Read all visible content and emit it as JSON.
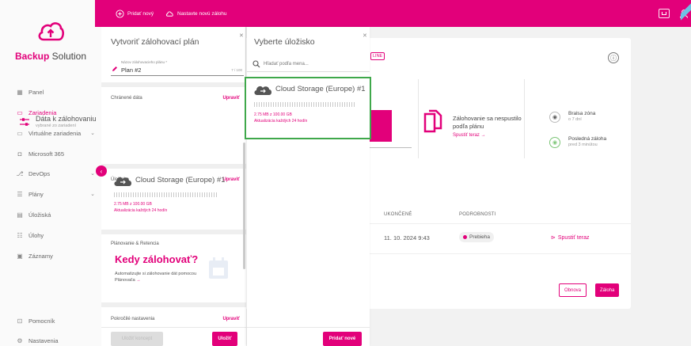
{
  "topbar": {
    "add_new": "Pridať nový",
    "set_backup": "Nastavte novú zálohu"
  },
  "sidebar": {
    "brand_first": "Backup",
    "brand_second": "Solution",
    "items": [
      {
        "label": "Panel",
        "icon": "grid-icon"
      },
      {
        "label": "Zariadenia",
        "icon": "devices-icon"
      },
      {
        "label": "Virtuálne zariadenia",
        "icon": "monitor-icon"
      },
      {
        "label": "Microsoft 365",
        "icon": "office-icon"
      },
      {
        "label": "DevOps",
        "icon": "branch-icon"
      },
      {
        "label": "Plány",
        "icon": "list-icon"
      },
      {
        "label": "Úložiská",
        "icon": "storage-icon"
      },
      {
        "label": "Úlohy",
        "icon": "tasks-icon"
      },
      {
        "label": "Záznamy",
        "icon": "log-icon"
      }
    ],
    "help": "Pomocník",
    "settings": "Nastavenia"
  },
  "plan_panel": {
    "title": "Vytvoriť zálohovací plán",
    "name_label": "Názov zálohovacieho plánu *",
    "name_value": "Plan #2",
    "name_count": "7 / 100",
    "protected_label": "Chránené dáta",
    "edit_label": "Upraviť",
    "data_title": "Dáta k zálohovaniu",
    "data_sub": "vybrané zo zariadení",
    "storage_label": "Úložisko",
    "storage_name": "Cloud Storage (Europe) #1",
    "storage_usage": "2.75 MB z 100.00 GB",
    "storage_update": "Aktualizácia každých 24 hodín",
    "schedule_label": "Plánovanie & Retencia",
    "when_title": "Kedy zálohovať?",
    "when_desc": "Automatizujte si zálohovanie dát pomocou Plánovača",
    "advanced_label": "Pokročilé nastavenia",
    "save_draft": "Uložiť koncept",
    "save": "Uložiť"
  },
  "storage_panel": {
    "title": "Vyberte úložisko",
    "search_placeholder": "Hľadať podľa mena...",
    "card_name": "Cloud Storage (Europe) #1",
    "card_usage": "2.75 MB z 100.00 GB",
    "card_update": "Aktualizácia každých 24 hodín",
    "add_new": "Pridať nové"
  },
  "background": {
    "badge": "LINE",
    "backup_fail": "Zálohovanie sa nespustilo podľa plánu",
    "run_now_link": "Spustiť teraz →",
    "stat1_title": "Bralsa zóna",
    "stat1_sub": "o 7 dní",
    "stat2_title": "Posledná záloha",
    "stat2_sub": "pred 3 minútou",
    "col_finished": "UKONČENÉ",
    "col_details": "PODROBNOSTI",
    "row_date": "11. 10. 2024 9:43",
    "row_status": "Prebieha",
    "row_action": "Spustiť teraz",
    "btn_refresh": "Obnova",
    "btn_backup": "Záloha"
  },
  "colors": {
    "accent": "#e2007a",
    "highlight": "#3fa84b"
  }
}
